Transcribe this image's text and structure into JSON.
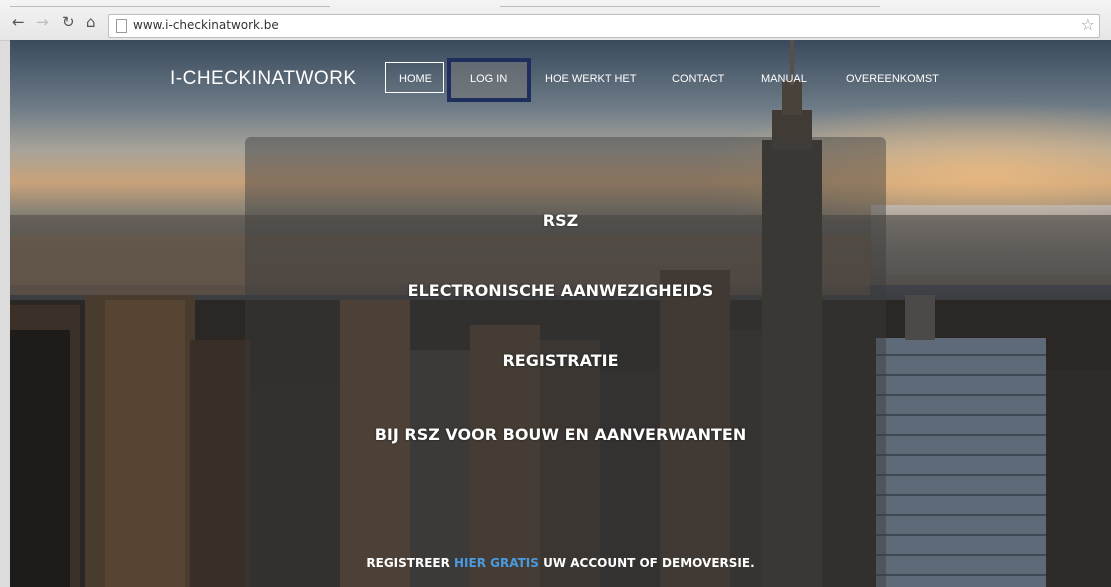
{
  "browser": {
    "url": "www.i-checkinatwork.be",
    "back_icon": "back-arrow-icon",
    "forward_icon": "forward-arrow-icon",
    "reload_icon": "reload-icon",
    "home_icon": "home-icon",
    "bookmark_icon": "star-icon"
  },
  "site": {
    "logo": "I-CHECKINATWORK",
    "menu": [
      {
        "label": "HOME"
      },
      {
        "label": "LOG IN"
      },
      {
        "label": "HOE WERKT HET"
      },
      {
        "label": "CONTACT"
      },
      {
        "label": "MANUAL"
      },
      {
        "label": "OVEREENKOMST"
      }
    ],
    "active_item": "HOME",
    "highlighted_item": "LOG IN",
    "highlight_color": "#1e2f5e"
  },
  "hero": {
    "line1": "RSZ",
    "line2": "ELECTRONISCHE AANWEZIGHEIDS",
    "line3": "REGISTRATIE",
    "line4": "BIJ RSZ VOOR BOUW EN AANVERWANTEN"
  },
  "cta": {
    "before": "REGISTREER ",
    "link": "HIER GRATIS",
    "after": " UW ACCOUNT OF DEMOVERSIE.",
    "link_color": "#4a9ae0"
  }
}
